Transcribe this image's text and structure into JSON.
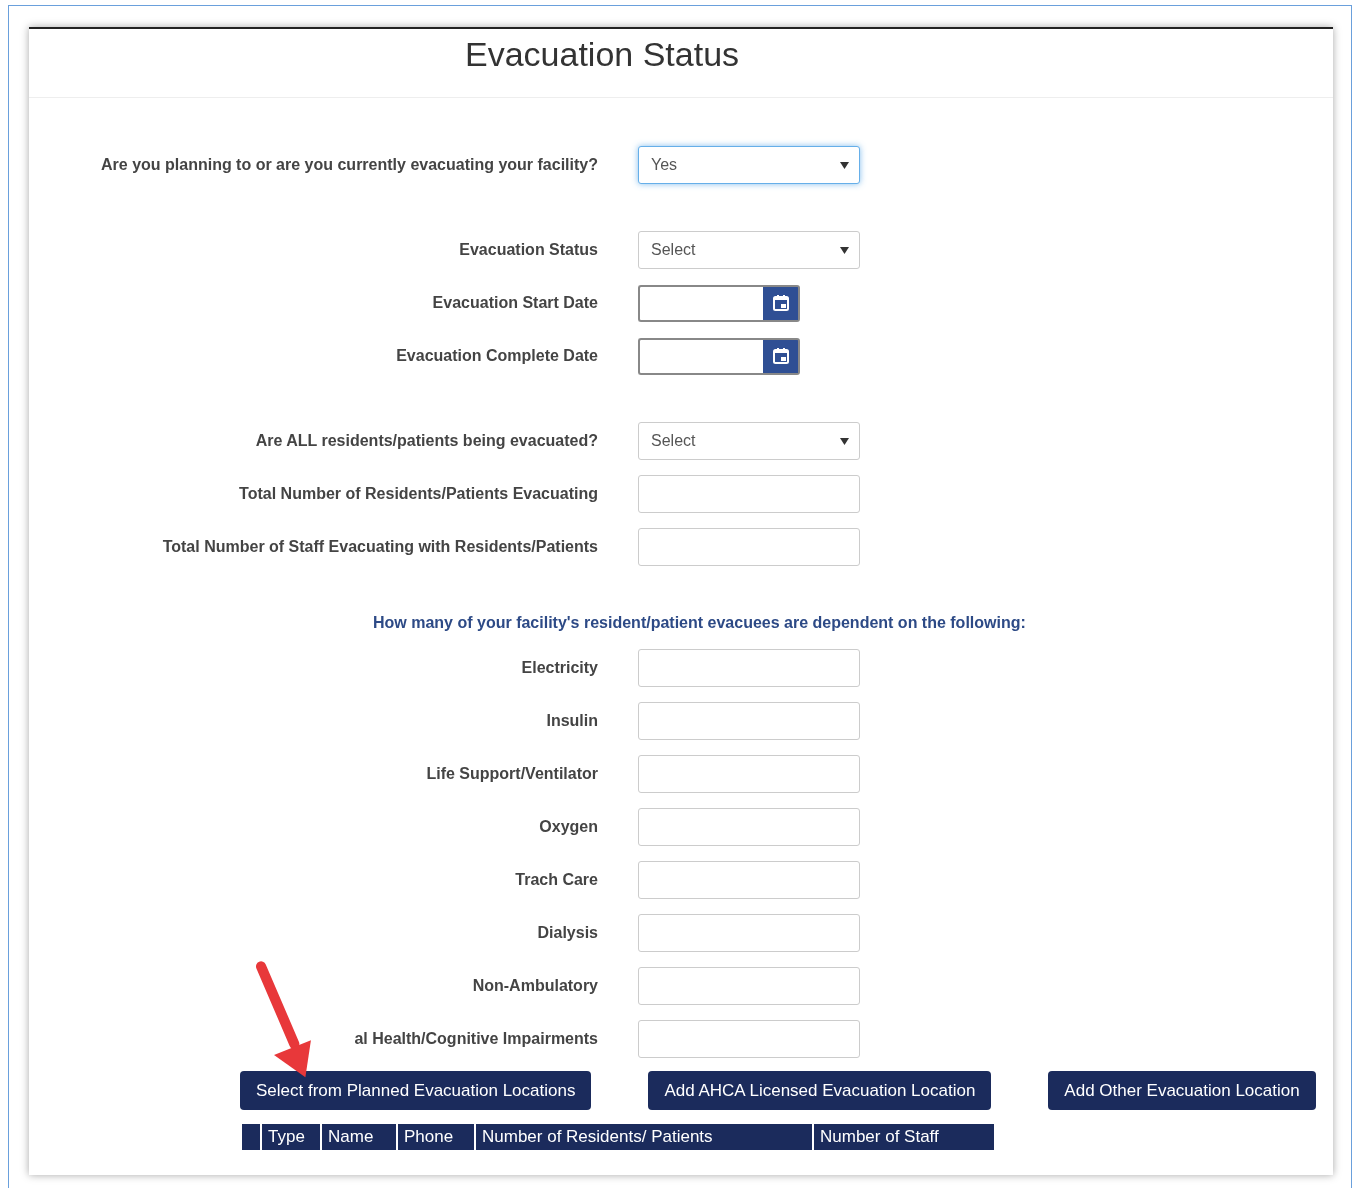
{
  "title": "Evacuation Status",
  "question_groups": [
    [
      {
        "label": "Are you planning to or are you currently evacuating your facility?",
        "kind": "select",
        "value": "Yes",
        "focused": true
      }
    ],
    [
      {
        "label": "Evacuation Status",
        "kind": "select",
        "value": "Select",
        "focused": false
      },
      {
        "label": "Evacuation Start Date",
        "kind": "date",
        "focused": false
      },
      {
        "label": "Evacuation Complete Date",
        "kind": "date",
        "focused": false
      }
    ],
    [
      {
        "label": "Are ALL residents/patients being evacuated?",
        "kind": "select",
        "value": "Select",
        "focused": false
      },
      {
        "label": "Total Number of Residents/Patients Evacuating",
        "kind": "text",
        "focused": false
      },
      {
        "label": "Total Number of Staff Evacuating with Residents/Patients",
        "kind": "text",
        "focused": false
      }
    ]
  ],
  "dependency_heading": "How many of your facility's resident/patient evacuees are dependent on the following:",
  "dependencies": [
    {
      "label": "Electricity",
      "kind": "text",
      "focused": false
    },
    {
      "label": "Insulin",
      "kind": "text",
      "focused": false
    },
    {
      "label": "Life Support/Ventilator",
      "kind": "text",
      "focused": false
    },
    {
      "label": "Oxygen",
      "kind": "text",
      "focused": false
    },
    {
      "label": "Trach Care",
      "kind": "text",
      "focused": false
    },
    {
      "label": "Dialysis",
      "kind": "text",
      "focused": false
    },
    {
      "label": "Non-Ambulatory",
      "kind": "text",
      "focused": false
    },
    {
      "label": "al Health/Cognitive Impairments",
      "kind": "text",
      "focused": false
    }
  ],
  "buttons": [
    "Select from Planned Evacuation Locations",
    "Add AHCA Licensed Evacuation Location",
    "Add Other Evacuation Location"
  ],
  "table": {
    "columns": [
      "Type",
      "Name",
      "Phone",
      "Number of Residents/ Patients",
      "Number of Staff"
    ]
  }
}
